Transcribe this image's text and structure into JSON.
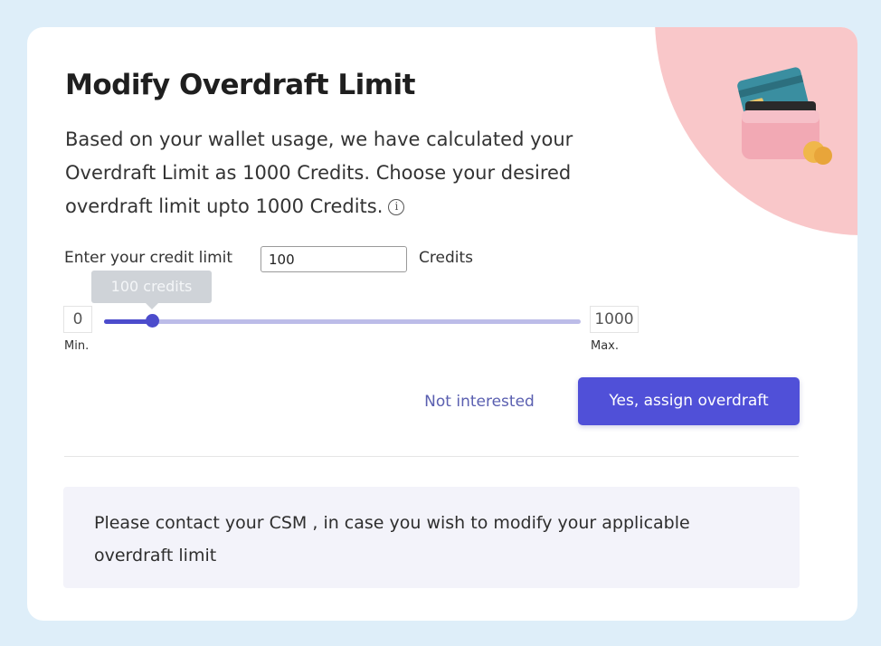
{
  "dialog": {
    "title": "Modify Overdraft Limit",
    "description": "Based on your wallet usage, we have calculated your Overdraft Limit as 1000 Credits. Choose your desired overdraft limit upto 1000 Credits.",
    "info_icon_glyph": "i"
  },
  "limit_input": {
    "label": "Enter your credit limit",
    "value": "100",
    "unit": "Credits"
  },
  "slider": {
    "tooltip": "100 credits",
    "value": 100,
    "min": "0",
    "max": "1000",
    "min_value": 0,
    "max_value": 1000,
    "min_caption": "Min.",
    "max_caption": "Max."
  },
  "actions": {
    "decline_label": "Not interested",
    "confirm_label": "Yes, assign overdraft"
  },
  "note": {
    "text": "Please contact your CSM , in case you wish to modify your applicable overdraft limit"
  },
  "colors": {
    "primary": "#5050d8",
    "slider_track": "#bcbce8",
    "decor_blob": "#f9c7c9",
    "page_background": "#deeef9"
  },
  "icons": {
    "illustration": "wallet-with-cards-and-coins-illustration",
    "info": "info-icon"
  }
}
